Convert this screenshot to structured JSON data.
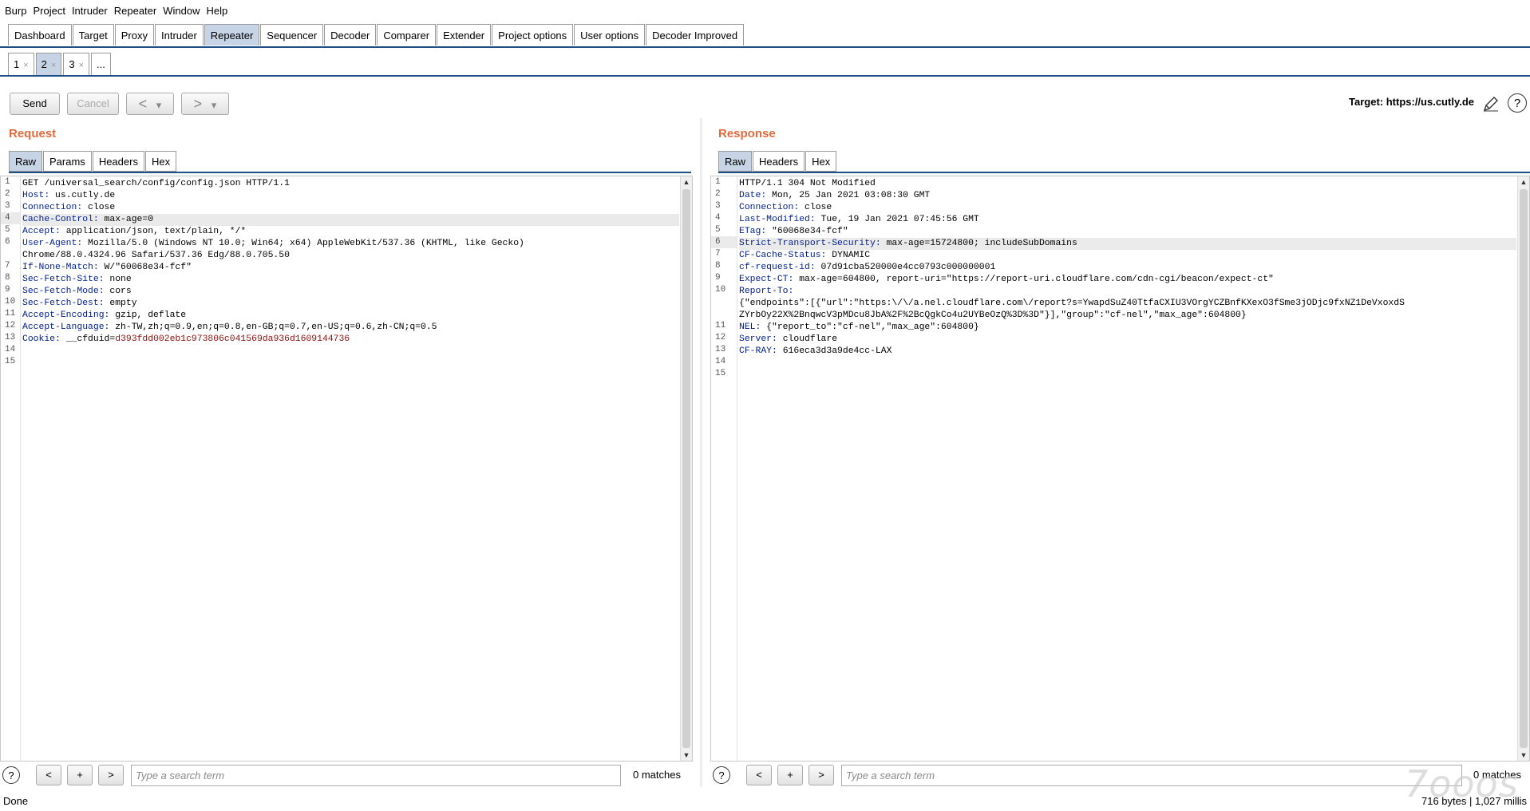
{
  "menubar": [
    "Burp",
    "Project",
    "Intruder",
    "Repeater",
    "Window",
    "Help"
  ],
  "main_tabs": [
    "Dashboard",
    "Target",
    "Proxy",
    "Intruder",
    "Repeater",
    "Sequencer",
    "Decoder",
    "Comparer",
    "Extender",
    "Project options",
    "User options",
    "Decoder Improved"
  ],
  "main_tab_selected": "Repeater",
  "sub_tabs": [
    {
      "label": "1",
      "close": "×"
    },
    {
      "label": "2",
      "close": "×"
    },
    {
      "label": "3",
      "close": "×"
    },
    {
      "label": "...",
      "close": ""
    }
  ],
  "sub_tab_selected": "2",
  "toolbar": {
    "send": "Send",
    "cancel": "Cancel",
    "back": "<",
    "forward": ">",
    "dropdown": "▾",
    "target": "Target: https://us.cutly.de",
    "edit_icon": "pencil-icon",
    "help_icon": "help-icon",
    "help_glyph": "?"
  },
  "request": {
    "title": "Request",
    "tabs": [
      "Raw",
      "Params",
      "Headers",
      "Hex"
    ],
    "selected_tab": "Raw",
    "lines": [
      {
        "n": "1",
        "k": "",
        "v": "GET /universal_search/config/config.json HTTP/1.1"
      },
      {
        "n": "2",
        "k": "Host:",
        "v": " us.cutly.de"
      },
      {
        "n": "3",
        "k": "Connection:",
        "v": " close"
      },
      {
        "n": "4",
        "k": "Cache-Control:",
        "v": " max-age=0",
        "hl": true
      },
      {
        "n": "5",
        "k": "Accept:",
        "v": " application/json, text/plain, */*"
      },
      {
        "n": "6",
        "k": "User-Agent:",
        "v": " Mozilla/5.0 (Windows NT 10.0; Win64; x64) AppleWebKit/537.36 (KHTML, like Gecko)"
      },
      {
        "n": "",
        "k": "",
        "v": "Chrome/88.0.4324.96 Safari/537.36 Edg/88.0.705.50"
      },
      {
        "n": "7",
        "k": "If-None-Match:",
        "v": " W/\"60068e34-fcf\""
      },
      {
        "n": "8",
        "k": "Sec-Fetch-Site:",
        "v": " none"
      },
      {
        "n": "9",
        "k": "Sec-Fetch-Mode:",
        "v": " cors"
      },
      {
        "n": "10",
        "k": "Sec-Fetch-Dest:",
        "v": " empty"
      },
      {
        "n": "11",
        "k": "Accept-Encoding:",
        "v": " gzip, deflate"
      },
      {
        "n": "12",
        "k": "Accept-Language:",
        "v": " zh-TW,zh;q=0.9,en;q=0.8,en-GB;q=0.7,en-US;q=0.6,zh-CN;q=0.5"
      },
      {
        "n": "13",
        "k": "Cookie:",
        "v": " __cfduid=",
        "c": "d393fdd002eb1c973806c041569da936d1609144736"
      },
      {
        "n": "14",
        "k": "",
        "v": ""
      },
      {
        "n": "15",
        "k": "",
        "v": ""
      }
    ]
  },
  "response": {
    "title": "Response",
    "tabs": [
      "Raw",
      "Headers",
      "Hex"
    ],
    "selected_tab": "Raw",
    "lines": [
      {
        "n": "1",
        "k": "",
        "v": "HTTP/1.1 304 Not Modified"
      },
      {
        "n": "2",
        "k": "Date:",
        "v": " Mon, 25 Jan 2021 03:08:30 GMT"
      },
      {
        "n": "3",
        "k": "Connection:",
        "v": " close"
      },
      {
        "n": "4",
        "k": "Last-Modified:",
        "v": " Tue, 19 Jan 2021 07:45:56 GMT"
      },
      {
        "n": "5",
        "k": "ETag:",
        "v": " \"60068e34-fcf\""
      },
      {
        "n": "6",
        "k": "Strict-Transport-Security:",
        "v": " max-age=15724800; includeSubDomains",
        "hl": true
      },
      {
        "n": "7",
        "k": "CF-Cache-Status:",
        "v": " DYNAMIC"
      },
      {
        "n": "8",
        "k": "cf-request-id:",
        "v": " 07d91cba520000e4cc0793c000000001"
      },
      {
        "n": "9",
        "k": "Expect-CT:",
        "v": " max-age=604800, report-uri=\"https://report-uri.cloudflare.com/cdn-cgi/beacon/expect-ct\""
      },
      {
        "n": "10",
        "k": "Report-To:",
        "v": ""
      },
      {
        "n": "",
        "k": "",
        "v": "{\"endpoints\":[{\"url\":\"https:\\/\\/a.nel.cloudflare.com\\/report?s=YwapdSuZ40TtfaCXIU3VOrgYCZBnfKXexO3fSme3jODjc9fxNZ1DeVxoxdS"
      },
      {
        "n": "",
        "k": "",
        "v": "ZYrbOy22X%2BnqwcV3pMDcu8JbA%2F%2BcQgkCo4u2UYBeOzQ%3D%3D\"}],\"group\":\"cf-nel\",\"max_age\":604800}"
      },
      {
        "n": "11",
        "k": "NEL:",
        "v": " {\"report_to\":\"cf-nel\",\"max_age\":604800}"
      },
      {
        "n": "12",
        "k": "Server:",
        "v": " cloudflare"
      },
      {
        "n": "13",
        "k": "CF-RAY:",
        "v": " 616eca3d3a9de4cc-LAX"
      },
      {
        "n": "14",
        "k": "",
        "v": ""
      },
      {
        "n": "15",
        "k": "",
        "v": ""
      }
    ]
  },
  "search": {
    "help": "?",
    "prev": "<",
    "add": "+",
    "next": ">",
    "placeholder": "Type a search term",
    "matches": "0 matches"
  },
  "statusbar": {
    "left": "Done",
    "right": "716 bytes | 1,027 millis"
  },
  "watermark": "7ooos"
}
